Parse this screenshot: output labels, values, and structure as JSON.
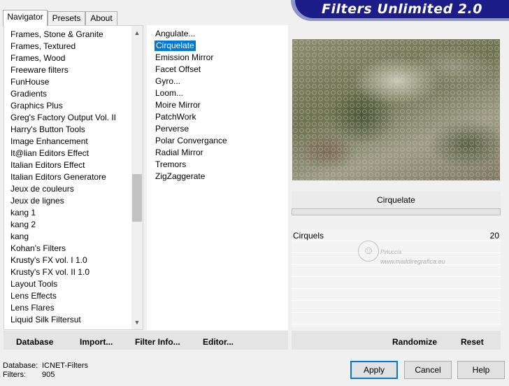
{
  "tabs": [
    "Navigator",
    "Presets",
    "About"
  ],
  "banner_title": "Filters Unlimited 2.0",
  "categories": [
    "Frames, Stone & Granite",
    "Frames, Textured",
    "Frames, Wood",
    "Freeware filters",
    "FunHouse",
    "Gradients",
    "Graphics Plus",
    "Greg's Factory Output Vol. II",
    "Harry's Button Tools",
    "Image Enhancement",
    "It@lian Editors Effect",
    "Italian Editors Effect",
    "Italian Editors Generatore",
    "Jeux de couleurs",
    "Jeux de lignes",
    "kang 1",
    "kang 2",
    "kang",
    "Kohan's Filters",
    "Krusty's FX vol. I 1.0",
    "Krusty's FX vol. II 1.0",
    "Layout Tools",
    "Lens Effects",
    "Lens Flares",
    "Liquid Silk Filtersut"
  ],
  "filters": [
    "Angulate...",
    "Cirquelate",
    "Emission Mirror",
    "Facet Offset",
    "Gyro...",
    "Loom...",
    "Moire Mirror",
    "PatchWork",
    "Perverse",
    "Polar Convergance",
    "Radial Mirror",
    "Tremors",
    "ZigZaggerate"
  ],
  "selected_filter": "Cirquelate",
  "selected_filter_index": 1,
  "filter_title": "Cirquelate",
  "params": [
    {
      "label": "Cirquels",
      "value": "20"
    }
  ],
  "watermark": {
    "line1": "Pinuccia",
    "line2": "www.maildiregrafica.eu"
  },
  "left_buttons": {
    "database": "Database",
    "import": "Import...",
    "filter_info": "Filter Info...",
    "editor": "Editor..."
  },
  "right_buttons": {
    "randomize": "Randomize",
    "reset": "Reset"
  },
  "info": {
    "database_label": "Database:",
    "database_value": "ICNET-Filters",
    "filters_label": "Filters:",
    "filters_value": "905"
  },
  "dialog_buttons": {
    "apply": "Apply",
    "cancel": "Cancel",
    "help": "Help"
  },
  "colors": {
    "banner": "#1d1d8a",
    "selection": "#0078d7",
    "default_button_border": "#0078d7"
  }
}
